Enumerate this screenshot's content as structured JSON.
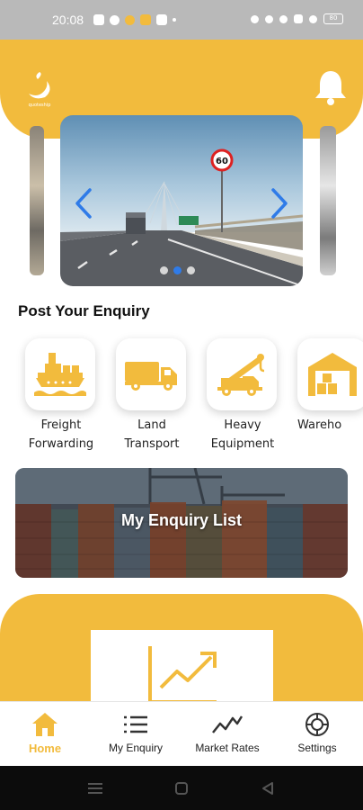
{
  "status_bar": {
    "time": "20:08",
    "battery": "80"
  },
  "header": {
    "logo_icon": "app-logo-icon",
    "logo_text": "quoteship",
    "bell_icon": "bell-icon"
  },
  "carousel": {
    "slide_count": 3,
    "active_index": 1,
    "speed_sign": "60"
  },
  "post_enquiry": {
    "title": "Post Your Enquiry",
    "services": [
      {
        "line1": "Freight",
        "line2": "Forwarding",
        "icon": "ship-icon"
      },
      {
        "line1": "Land",
        "line2": "Transport",
        "icon": "truck-icon"
      },
      {
        "line1": "Heavy",
        "line2": "Equipment",
        "icon": "crane-truck-icon"
      },
      {
        "line1": "Wareho",
        "line2": "",
        "icon": "warehouse-icon"
      }
    ]
  },
  "enquiry_list": {
    "title": "My Enquiry List"
  },
  "bottom_nav": {
    "items": [
      {
        "label": "Home",
        "icon": "home-icon"
      },
      {
        "label": "My Enquiry",
        "icon": "list-icon"
      },
      {
        "label": "Market Rates",
        "icon": "trend-icon"
      },
      {
        "label": "Settings",
        "icon": "gear-icon"
      }
    ]
  },
  "colors": {
    "accent": "#f2bb3d",
    "carousel_arrow": "#2f7be8"
  }
}
